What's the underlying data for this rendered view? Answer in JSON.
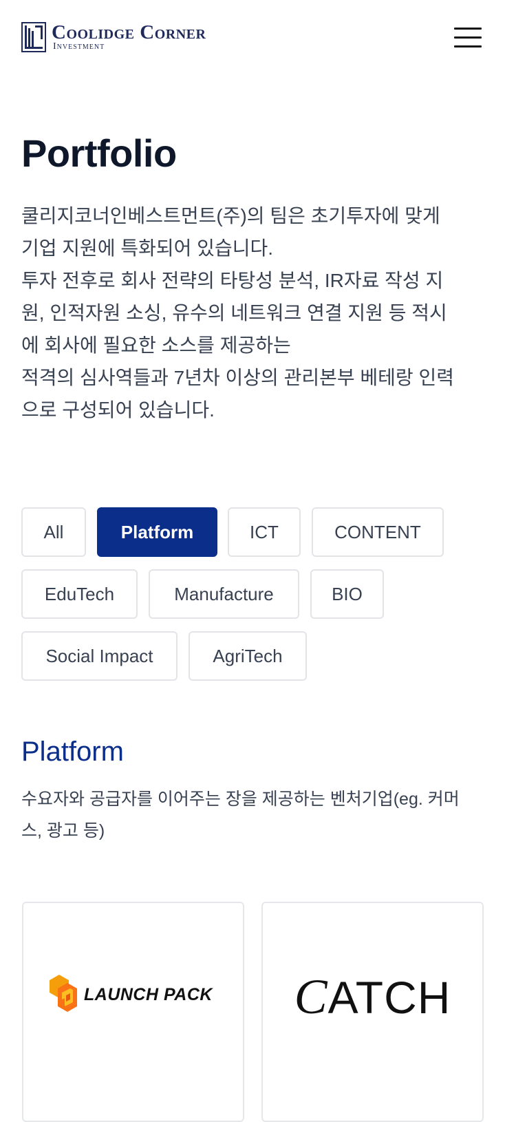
{
  "header": {
    "logo_line1": "Coolidge Corner",
    "logo_line2": "Investment"
  },
  "page": {
    "title": "Portfolio",
    "intro_lines": [
      "쿨리지코너인베스트먼트(주)의 팀은 초기투자에 맞게",
      "기업 지원에 특화되어 있습니다.",
      "투자 전후로 회사 전략의 타탕성 분석, IR자료 작성 지",
      "원, 인적자원 소싱, 유수의 네트워크 연결 지원 등 적시",
      "에 회사에 필요한 소스를 제공하는",
      "적격의 심사역들과 7년차 이상의 관리본부 베테랑 인력",
      "으로 구성되어 있습니다."
    ]
  },
  "filters": [
    {
      "label": "All",
      "active": false
    },
    {
      "label": "Platform",
      "active": true
    },
    {
      "label": "ICT",
      "active": false
    },
    {
      "label": "CONTENT",
      "active": false
    },
    {
      "label": "EduTech",
      "active": false
    },
    {
      "label": "Manufacture",
      "active": false
    },
    {
      "label": "BIO",
      "active": false
    },
    {
      "label": "Social Impact",
      "active": false
    },
    {
      "label": "AgriTech",
      "active": false
    }
  ],
  "section": {
    "title": "Platform",
    "desc_lines": [
      "수요자와 공급자를 이어주는 장을 제공하는 벤처기업(eg. 커머",
      "스, 광고 등)"
    ]
  },
  "cards": [
    {
      "name": "LAUNCH PACK"
    },
    {
      "name": "ATCH",
      "initial": "C"
    }
  ],
  "colors": {
    "accent": "#0b2e8a",
    "logo": "#1f2a5a",
    "launchpack_orange": "#f59e0b"
  }
}
